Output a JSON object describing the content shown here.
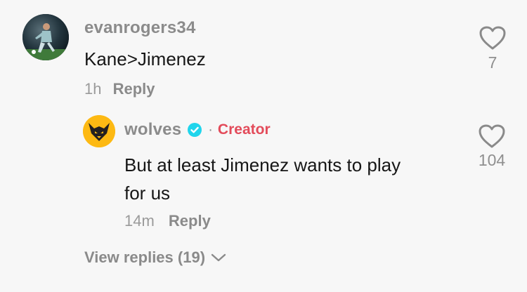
{
  "comment": {
    "username": "evanrogers34",
    "text": "Kane>Jimenez",
    "time": "1h",
    "reply_label": "Reply",
    "likes": "7"
  },
  "reply": {
    "username": "wolves",
    "badge": "Creator",
    "separator": "·",
    "text_line1": "But at least Jimenez wants to play",
    "text_line2": "for us",
    "time": "14m",
    "reply_label": "Reply",
    "likes": "104"
  },
  "view_replies": "View replies (19)",
  "colors": {
    "creator_badge": "#e34b5a",
    "verified": "#20d5ec",
    "wolves_gold": "#fdb913"
  }
}
